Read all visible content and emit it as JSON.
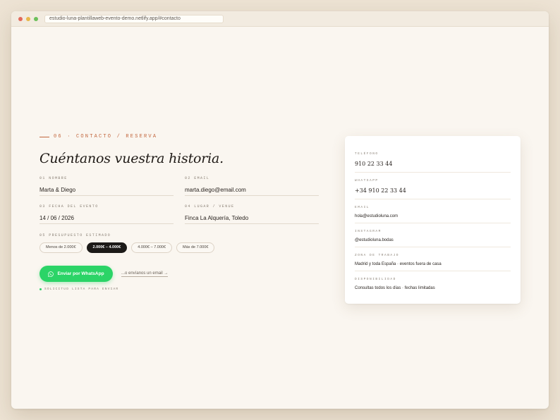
{
  "browser": {
    "url": "estudio-luna-plantillaweb-evento-demo.netlify.app/#contacto"
  },
  "section": {
    "eyebrow": "06 · Contacto / Reserva",
    "title": "Cuéntanos vuestra historia."
  },
  "form": {
    "fields": [
      {
        "label": "01 Nombre",
        "value": "Marta & Diego"
      },
      {
        "label": "02 Email",
        "value": "marta.diego@email.com"
      },
      {
        "label": "03 Fecha del evento",
        "value": "14 / 06 / 2026"
      },
      {
        "label": "04 Lugar / venue",
        "value": "Finca La Alquería, Toledo"
      }
    ],
    "budget_label": "05 Presupuesto estimado",
    "budget_options": [
      "Menos de 2.000€",
      "2.000€ – 4.000€",
      "4.000€ – 7.000€",
      "Más de 7.000€"
    ],
    "budget_selected": "2.000€ – 4.000€",
    "whatsapp_label": "Enviar por WhatsApp",
    "email_link": "...o envíanos un email →",
    "status": "Solicitud lista para enviar"
  },
  "contact": [
    {
      "label": "Teléfono",
      "value": "910 22 33 44"
    },
    {
      "label": "WhatsApp",
      "value": "+34 910 22 33 44"
    },
    {
      "label": "Email",
      "value": "hola@estudioluna.com"
    },
    {
      "label": "Instagram",
      "value": "@estudioluna.bodas"
    },
    {
      "label": "Zona de trabajo",
      "value": "Madrid y toda España · eventos fuera de casa"
    },
    {
      "label": "Disponibilidad",
      "value": "Consultas todos los días · fechas limitadas"
    }
  ],
  "colors": {
    "accent": "#c2663d",
    "whatsapp": "#2bd467",
    "pill_active": "#1c1a18",
    "background": "#faf6f0"
  }
}
